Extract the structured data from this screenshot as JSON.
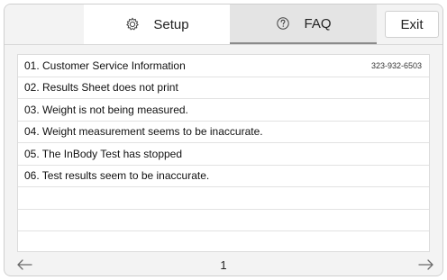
{
  "header": {
    "tabs": [
      {
        "label": "Setup",
        "icon": "gear-icon",
        "active": false
      },
      {
        "label": "FAQ",
        "icon": "help-icon",
        "active": true
      }
    ],
    "exit_label": "Exit"
  },
  "faq": {
    "items": [
      {
        "label": "01. Customer Service Information",
        "extra": "323-932-6503"
      },
      {
        "label": "02. Results Sheet does not print",
        "extra": ""
      },
      {
        "label": "03. Weight is not being measured.",
        "extra": ""
      },
      {
        "label": "04. Weight measurement seems to be inaccurate.",
        "extra": ""
      },
      {
        "label": "05. The InBody Test has stopped",
        "extra": ""
      },
      {
        "label": "06. Test results seem to be inaccurate.",
        "extra": ""
      }
    ]
  },
  "pagination": {
    "page": "1",
    "prev_icon": "arrow-left-icon",
    "next_icon": "arrow-right-icon"
  },
  "colors": {
    "background": "#f3f3f3",
    "active_tab": "#e4e4e4",
    "active_underline": "#8a8a8a"
  }
}
